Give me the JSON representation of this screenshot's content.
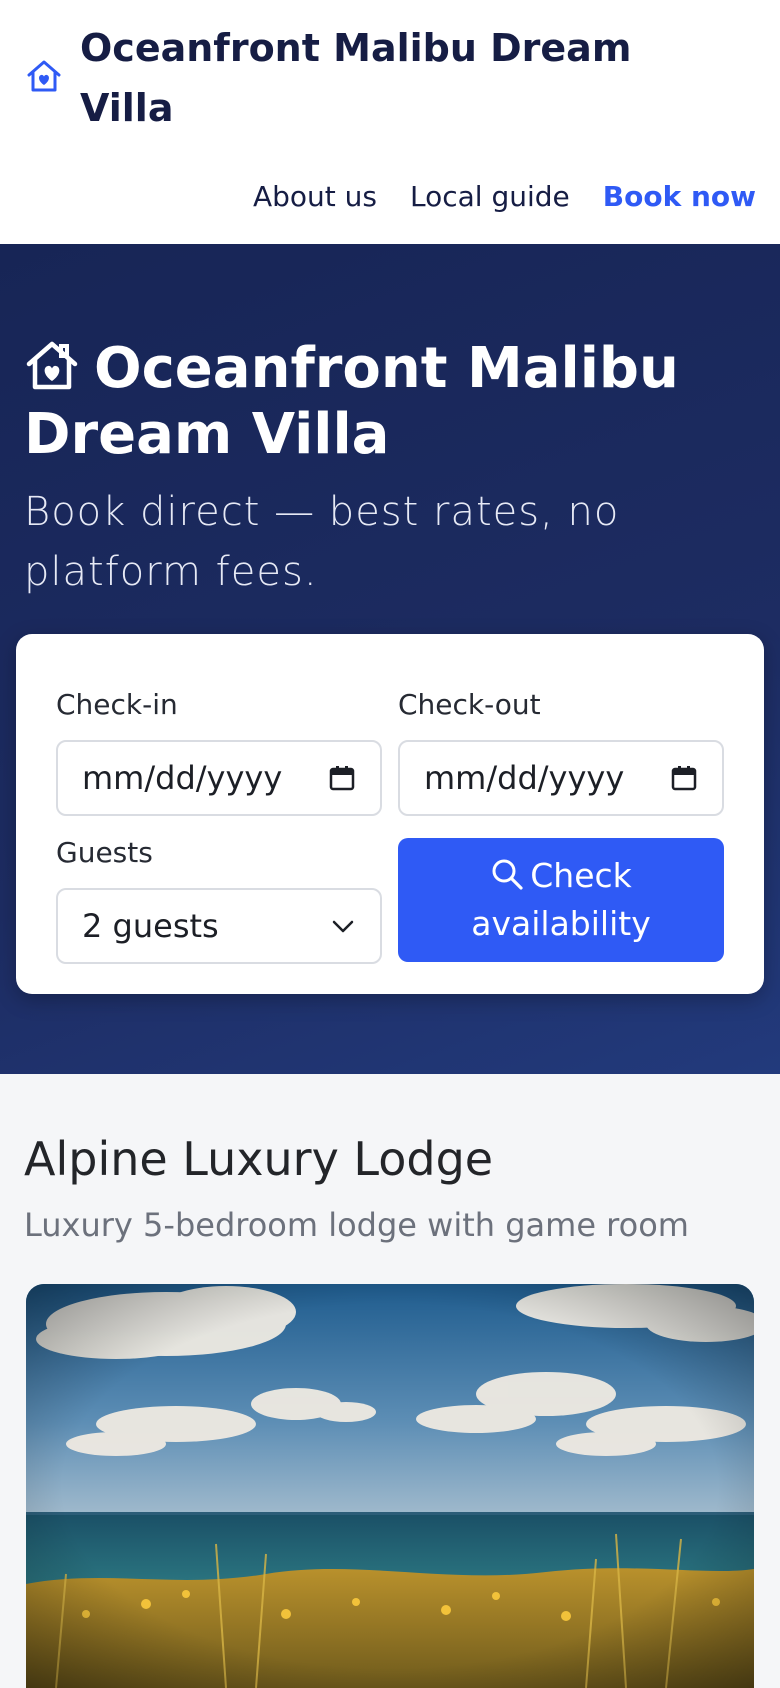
{
  "header": {
    "brand_title": "Oceanfront Malibu Dream Villa",
    "brand_icon": "house-heart-icon",
    "nav": [
      {
        "label": "About us"
      },
      {
        "label": "Local guide"
      },
      {
        "label": "Book now"
      }
    ]
  },
  "hero": {
    "title": "Oceanfront Malibu Dream Villa",
    "title_icon": "house-heart-icon",
    "subtitle": "Book direct — best rates, no platform fees."
  },
  "booking": {
    "checkin_label": "Check-in",
    "checkin_value": "mm/dd/yyyy",
    "checkout_label": "Check-out",
    "checkout_value": "mm/dd/yyyy",
    "guests_label": "Guests",
    "guests_value": "2 guests",
    "submit_label": "Check availability"
  },
  "listing": {
    "title": "Alpine Luxury Lodge",
    "subtitle": "Luxury 5-bedroom lodge with game room",
    "image_description": "ocean-meadow-photo"
  },
  "colors": {
    "brand": "#161d44",
    "accent": "#2f5af5",
    "hero_bg": "#1d2c62"
  }
}
